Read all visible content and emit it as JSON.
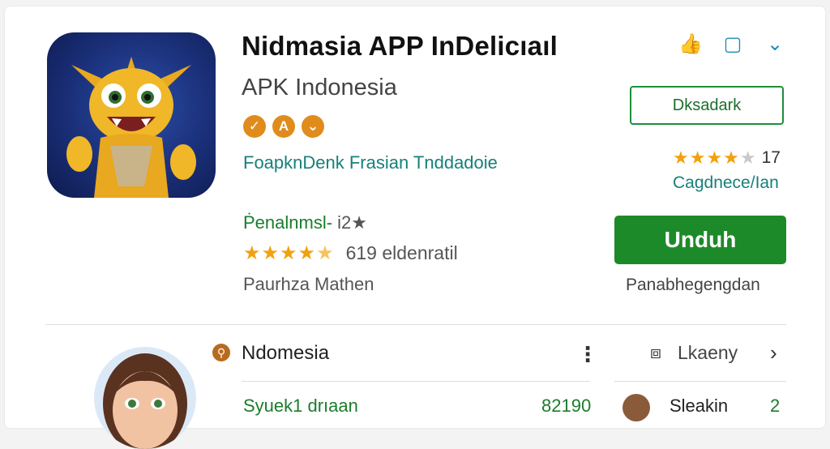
{
  "app": {
    "title": "Nidmasia APP InDelicıaıl",
    "developer": "APK Indonesia",
    "badges": [
      "✓",
      "A",
      "⌄"
    ],
    "tagline": "FoapknDenk Frasian Tnddadoie",
    "subinfo_label": "Ṗenalnmsl-",
    "subinfo_value": "i2★",
    "stars_full": "★★★★",
    "stars_half": "★",
    "rating_text": "619 eldenratil",
    "author": "Paurhza Mathen"
  },
  "top_icons": [
    "thumb-icon",
    "bookmark-icon",
    "chevron-down-icon"
  ],
  "top_icon_glyphs": [
    "👍",
    "▢",
    "⌄"
  ],
  "wishlist_button": "Dksadark",
  "right_rating": {
    "stars_full": "★★★★",
    "stars_empty": "★",
    "count": "17",
    "category": "Cagdnece/Ian"
  },
  "install_button": "Unduh",
  "install_note": "Panabhegengdan",
  "section": {
    "title": "Ndomesia",
    "more_glyph": "⋮",
    "item_label": "Syuek1 drıaan",
    "item_value": "82190"
  },
  "tag": {
    "glyph": "⧈",
    "label": "Lkaeny",
    "chevron": "›",
    "small_label": "Sleakin",
    "small_value": "2"
  },
  "colors": {
    "accent_green": "#1d8a2a",
    "teal_text": "#17807a",
    "star": "#f2a10f",
    "badge_orange": "#e08c1c"
  }
}
